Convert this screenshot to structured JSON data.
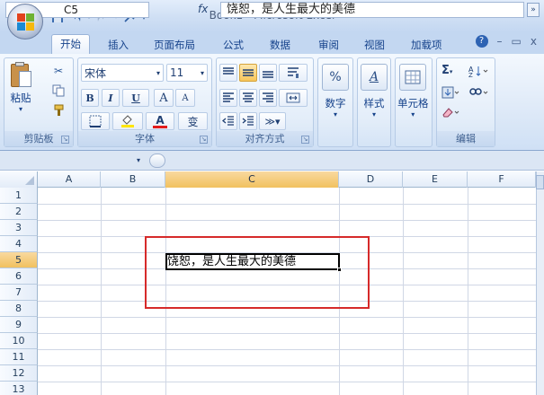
{
  "window": {
    "title": "Book1 - Microsoft Excel",
    "minimize": "–",
    "restore": "▭",
    "close": "✕"
  },
  "quick_access": {
    "save_icon": "save-icon",
    "undo_icon": "undo-icon",
    "redo_icon": "redo-icon",
    "custom_icon": "customize-qat-icon"
  },
  "tabs": [
    {
      "label": "开始",
      "active": true
    },
    {
      "label": "插入"
    },
    {
      "label": "页面布局"
    },
    {
      "label": "公式"
    },
    {
      "label": "数据"
    },
    {
      "label": "审阅"
    },
    {
      "label": "视图"
    },
    {
      "label": "加载项"
    }
  ],
  "ribbon_controls": {
    "help": "?",
    "minimize": "–",
    "restore": "▭",
    "close": "x"
  },
  "ribbon": {
    "clipboard": {
      "label": "剪贴板",
      "paste": "粘贴"
    },
    "font": {
      "label": "字体",
      "font_name": "宋体",
      "font_size": "11",
      "bold": "B",
      "italic": "I",
      "underline": "U",
      "grow": "A",
      "shrink": "A",
      "font_color_letter": "A",
      "phonetic": "变"
    },
    "alignment": {
      "label": "对齐方式"
    },
    "number": {
      "label": "数字"
    },
    "styles": {
      "label": "样式"
    },
    "cells": {
      "label": "单元格"
    },
    "editing": {
      "label": "编辑",
      "sum": "Σ"
    }
  },
  "formula_bar": {
    "name_box": "C5",
    "fx": "fx",
    "content": "饶恕，是人生最大的美德"
  },
  "sheet": {
    "columns": [
      "A",
      "B",
      "C",
      "D",
      "E",
      "F"
    ],
    "selected_column": "C",
    "rows": [
      "1",
      "2",
      "3",
      "4",
      "5",
      "6",
      "7",
      "8",
      "9",
      "10",
      "11",
      "12",
      "13"
    ],
    "selected_row": "5",
    "active_cell": "C5",
    "active_cell_text": "饶恕，是人生最大的美德"
  },
  "colors": {
    "accent": "#15428b",
    "selection": "#f1c15f",
    "highlight_box": "#d62a2a"
  }
}
